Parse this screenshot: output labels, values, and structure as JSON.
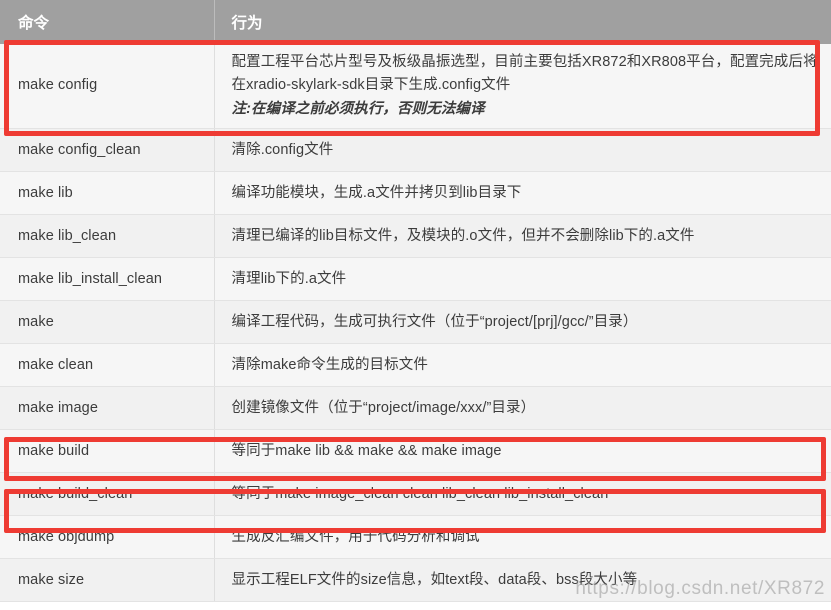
{
  "table": {
    "headers": {
      "command": "命令",
      "action": "行为"
    },
    "rows": [
      {
        "command": "make config",
        "action": "配置工程平台芯片型号及板级晶振选型，目前主要包括XR872和XR808平台，配置完成后将在xradio-skylark-sdk目录下生成.config文件",
        "note": "注:在编译之前必须执行，否则无法编译",
        "highlighted": true
      },
      {
        "command": "make config_clean",
        "action": "清除.config文件",
        "note": "",
        "highlighted": false
      },
      {
        "command": "make lib",
        "action": "编译功能模块，生成.a文件并拷贝到lib目录下",
        "note": "",
        "highlighted": false
      },
      {
        "command": "make lib_clean",
        "action": "清理已编译的lib目标文件，及模块的.o文件，但并不会删除lib下的.a文件",
        "note": "",
        "highlighted": false
      },
      {
        "command": "make lib_install_clean",
        "action": "清理lib下的.a文件",
        "note": "",
        "highlighted": false
      },
      {
        "command": "make",
        "action": "编译工程代码，生成可执行文件（位于“project/[prj]/gcc/”目录）",
        "note": "",
        "highlighted": false
      },
      {
        "command": "make clean",
        "action": "清除make命令生成的目标文件",
        "note": "",
        "highlighted": false
      },
      {
        "command": "make image",
        "action": "创建镜像文件（位于“project/image/xxx/”目录）",
        "note": "",
        "highlighted": false
      },
      {
        "command": "make build",
        "action": "等同于make lib && make && make image",
        "note": "",
        "highlighted": true
      },
      {
        "command": "make build_clean",
        "action": "等同于make image_clean clean lib_clean lib_install_clean",
        "note": "",
        "highlighted": true
      },
      {
        "command": "make objdump",
        "action": "生成反汇编文件，用于代码分析和调试",
        "note": "",
        "highlighted": false
      },
      {
        "command": "make size",
        "action": "显示工程ELF文件的size信息，如text段、data段、bss段大小等",
        "note": "",
        "highlighted": false
      }
    ]
  },
  "annotations": {
    "highlight_color": "#ee3b33",
    "boxes": [
      {
        "label": "make-config-highlight"
      },
      {
        "label": "make-build-highlight"
      },
      {
        "label": "make-build-clean-highlight"
      }
    ]
  },
  "watermark": {
    "text": "https://blog.csdn.net/XR872"
  },
  "theme": {
    "header_bg": "#a0a0a0",
    "header_text": "#ffffff",
    "row_bg_odd": "#f6f6f6",
    "row_bg_even": "#f1f1f1",
    "text_color": "#3c3c3c",
    "divider": "#e3e3e3"
  }
}
